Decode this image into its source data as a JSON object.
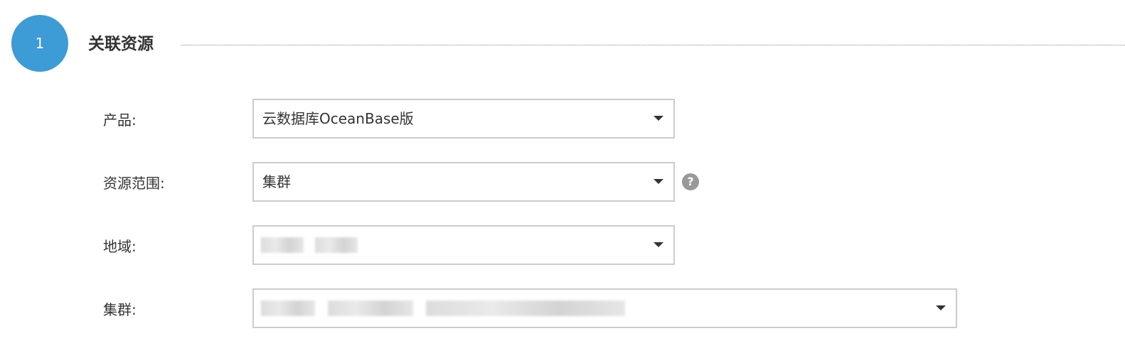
{
  "step": {
    "number": "1",
    "title": "关联资源"
  },
  "form": {
    "product": {
      "label": "产品:",
      "value": "云数据库OceanBase版"
    },
    "scope": {
      "label": "资源范围:",
      "value": "集群",
      "help_icon": "?"
    },
    "region": {
      "label": "地域:"
    },
    "cluster": {
      "label": "集群:"
    }
  },
  "icons": {
    "caret": "caret-down-icon",
    "help": "question-circle-icon"
  },
  "colors": {
    "step_circle": "#3d9bd6",
    "help_icon": "#999999",
    "border": "#cccccc"
  }
}
